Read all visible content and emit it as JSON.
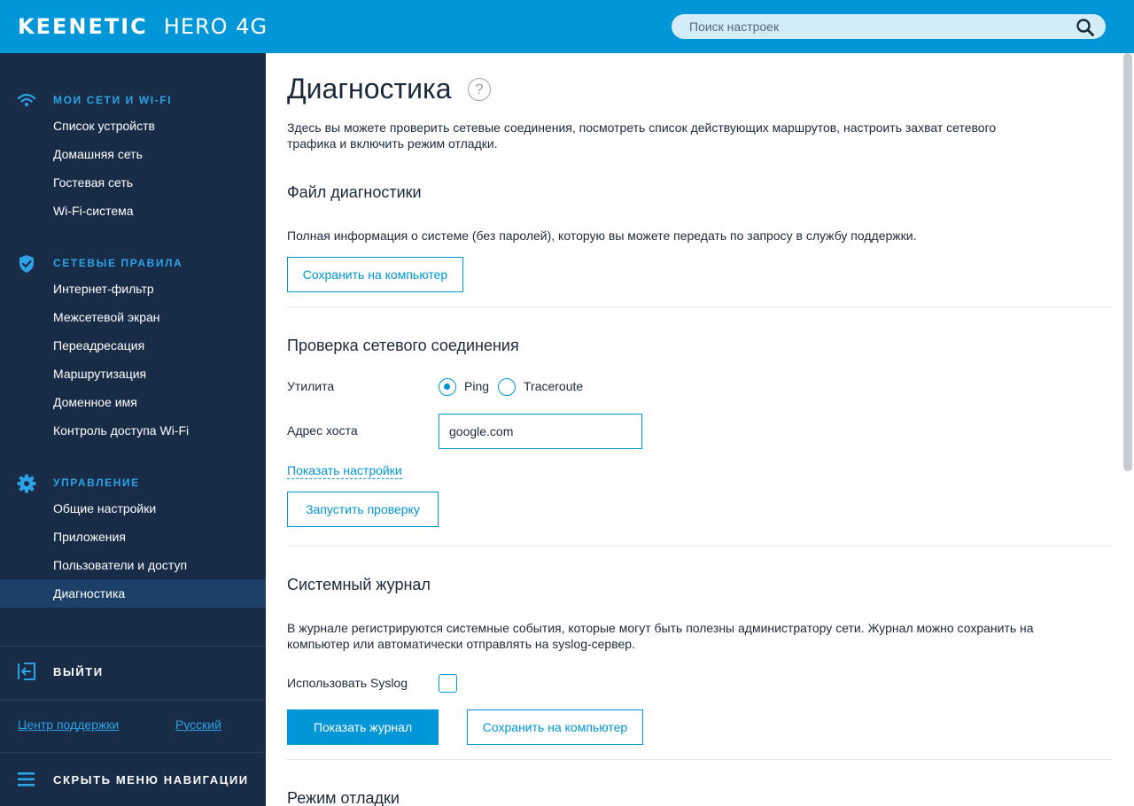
{
  "header": {
    "brand": "KEENETIC",
    "model": "HERO 4G",
    "search_placeholder": "Поиск настроек",
    "accent": "#0096d8"
  },
  "sidebar": {
    "sections": [
      {
        "title": "МОИ СЕТИ И WI-FI",
        "icon": "wifi-icon",
        "items": [
          "Список устройств",
          "Домашняя сеть",
          "Гостевая сеть",
          "Wi-Fi-система"
        ]
      },
      {
        "title": "СЕТЕВЫЕ ПРАВИЛА",
        "icon": "shield-icon",
        "items": [
          "Интернет-фильтр",
          "Межсетевой экран",
          "Переадресация",
          "Маршрутизация",
          "Доменное имя",
          "Контроль доступа Wi-Fi"
        ]
      },
      {
        "title": "УПРАВЛЕНИЕ",
        "icon": "gear-icon",
        "items": [
          "Общие настройки",
          "Приложения",
          "Пользователи и доступ",
          "Диагностика"
        ]
      }
    ],
    "active_item": "Диагностика",
    "logout_label": "ВЫЙТИ",
    "support_link": "Центр поддержки",
    "language_link": "Русский",
    "hide_nav_label": "СКРЫТЬ МЕНЮ НАВИГАЦИИ",
    "background": "#182c47"
  },
  "main": {
    "title": "Диагностика",
    "help_glyph": "?",
    "intro": "Здесь вы можете проверить сетевые соединения, посмотреть список действующих маршрутов, настроить захват сетевого трафика и включить режим отладки.",
    "diag_file": {
      "title": "Файл диагностики",
      "description": "Полная информация о системе (без паролей), которую вы можете передать по запросу в службу поддержки.",
      "save_button": "Сохранить на компьютер"
    },
    "conn_check": {
      "title": "Проверка сетевого соединения",
      "utility_label": "Утилита",
      "options": [
        "Ping",
        "Traceroute"
      ],
      "selected": "Ping",
      "host_label": "Адрес хоста",
      "host_value": "google.com",
      "show_settings": "Показать настройки",
      "run_button": "Запустить проверку"
    },
    "syslog": {
      "title": "Системный журнал",
      "description": "В журнале регистрируются системные события, которые могут быть полезны администратору сети. Журнал можно сохранить на компьютер или автоматически отправлять на syslog-сервер.",
      "use_syslog_label": "Использовать Syslog",
      "use_syslog_checked": false,
      "show_log_button": "Показать журнал",
      "save_button": "Сохранить на компьютер"
    },
    "debug": {
      "title": "Режим отладки"
    }
  }
}
